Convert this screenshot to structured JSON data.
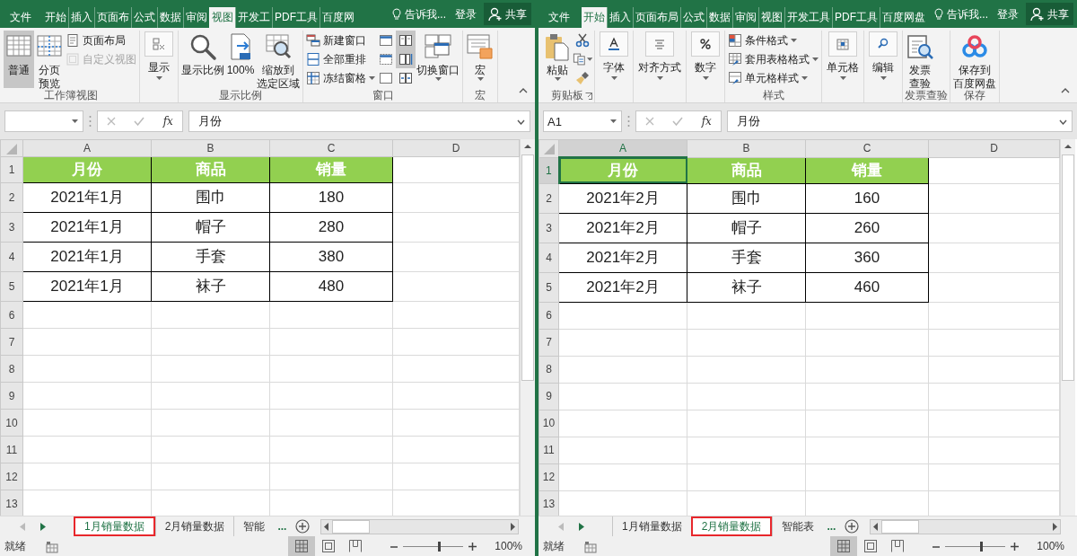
{
  "windows": [
    {
      "tabs": [
        {
          "label": "文件",
          "selected": false
        },
        {
          "label": "开始",
          "selected": false
        },
        {
          "label": "插入",
          "selected": false
        },
        {
          "label": "页面布",
          "selected": false
        },
        {
          "label": "公式",
          "selected": false
        },
        {
          "label": "数据",
          "selected": false
        },
        {
          "label": "审阅",
          "selected": false
        },
        {
          "label": "视图",
          "selected": true
        },
        {
          "label": "开发工",
          "selected": false
        },
        {
          "label": "PDF工具",
          "selected": false
        },
        {
          "label": "百度网",
          "selected": false
        }
      ],
      "tell_me": "告诉我...",
      "sign_in": "登录",
      "share": "共享",
      "ribbon": [
        {
          "label": "工作簿视图",
          "items": [
            {
              "kind": "large",
              "lines": [
                "普通"
              ],
              "selected": true
            },
            {
              "kind": "large",
              "lines": [
                "分页",
                "预览"
              ],
              "selected": false
            },
            {
              "kind": "small",
              "label": "页面布局",
              "disabled": false
            },
            {
              "kind": "small",
              "label": "自定义视图",
              "disabled": true
            }
          ]
        },
        {
          "items": [
            {
              "kind": "boxed",
              "label": "显示",
              "dropdown": true
            }
          ]
        },
        {
          "label": "显示比例",
          "items": [
            {
              "kind": "large",
              "lines": [
                "显示比例"
              ]
            },
            {
              "kind": "large",
              "lines": [
                "100%"
              ]
            },
            {
              "kind": "large",
              "lines": [
                "缩放到",
                "选定区域"
              ]
            }
          ]
        },
        {
          "label": "窗口",
          "items": [
            {
              "kind": "small",
              "label": "新建窗口"
            },
            {
              "kind": "small",
              "label": "全部重排"
            },
            {
              "kind": "small",
              "label": "冻结窗格",
              "dropdown": true
            },
            {
              "kind": "icon",
              "on": false
            },
            {
              "kind": "icon",
              "on": false
            },
            {
              "kind": "icon",
              "on": false
            },
            {
              "kind": "icon",
              "on": true
            },
            {
              "kind": "icon",
              "on": true
            },
            {
              "kind": "icon",
              "on": false
            },
            {
              "kind": "large",
              "lines": [
                "切换窗口"
              ],
              "dropdown": true
            }
          ]
        },
        {
          "label": "宏",
          "items": [
            {
              "kind": "large",
              "lines": [
                "宏"
              ],
              "dropdown": true
            }
          ]
        }
      ],
      "formula_bar": {
        "function_label": "fx",
        "formula": "月份"
      },
      "sheet": {
        "columns": [
          {
            "label": "A",
            "selected": false
          },
          {
            "label": "B",
            "selected": false
          },
          {
            "label": "C",
            "selected": false
          },
          {
            "label": "D",
            "selected": false
          }
        ],
        "rows": [
          {
            "label": "1",
            "kind": "header",
            "selected": false,
            "cells": [
              "月份",
              "商品",
              "销量"
            ]
          },
          {
            "label": "2",
            "kind": "data",
            "selected": false,
            "cells": [
              "2021年1月",
              "围巾",
              "180"
            ]
          },
          {
            "label": "3",
            "kind": "data",
            "selected": false,
            "cells": [
              "2021年1月",
              "帽子",
              "280"
            ]
          },
          {
            "label": "4",
            "kind": "data",
            "selected": false,
            "cells": [
              "2021年1月",
              "手套",
              "380"
            ]
          },
          {
            "label": "5",
            "kind": "data",
            "selected": false,
            "cells": [
              "2021年1月",
              "袜子",
              "480"
            ]
          },
          {
            "label": "6",
            "kind": "blank",
            "selected": false
          },
          {
            "label": "7",
            "kind": "blank",
            "selected": false
          },
          {
            "label": "8",
            "kind": "blank",
            "selected": false
          },
          {
            "label": "9",
            "kind": "blank",
            "selected": false
          },
          {
            "label": "10",
            "kind": "blank",
            "selected": false
          },
          {
            "label": "11",
            "kind": "blank",
            "selected": false
          },
          {
            "label": "12",
            "kind": "blank",
            "selected": false
          },
          {
            "label": "13",
            "kind": "blank",
            "selected": false
          }
        ]
      },
      "sheet_tabs": [
        {
          "label": "1月销量数据",
          "selected": true
        },
        {
          "label": "2月销量数据",
          "selected": false
        },
        {
          "label": "智能",
          "selected": false
        }
      ],
      "more_sheets": "...",
      "status": "就绪",
      "view_buttons": [
        {
          "selected": true
        },
        {
          "selected": false
        },
        {
          "selected": false
        }
      ],
      "zoom": {
        "level": 0.6,
        "label": "100%"
      }
    },
    {
      "tabs": [
        {
          "label": "文件",
          "selected": false
        },
        {
          "label": "开始",
          "selected": true
        },
        {
          "label": "插入",
          "selected": false
        },
        {
          "label": "页面布局",
          "selected": false
        },
        {
          "label": "公式",
          "selected": false
        },
        {
          "label": "数据",
          "selected": false
        },
        {
          "label": "审阅",
          "selected": false
        },
        {
          "label": "视图",
          "selected": false
        },
        {
          "label": "开发工具",
          "selected": false
        },
        {
          "label": "PDF工具",
          "selected": false
        },
        {
          "label": "百度网盘",
          "selected": false
        }
      ],
      "tell_me": "告诉我...",
      "sign_in": "登录",
      "share": "共享",
      "ribbon": [
        {
          "label": "剪贴板",
          "launcher": true,
          "items": [
            {
              "kind": "large",
              "lines": [
                "粘贴"
              ],
              "dropdown": true
            },
            {
              "kind": "icon"
            },
            {
              "kind": "icon",
              "dropdown": true
            },
            {
              "kind": "icon"
            }
          ]
        },
        {
          "items": [
            {
              "kind": "boxed",
              "label": "字体",
              "dropdown": true
            }
          ]
        },
        {
          "items": [
            {
              "kind": "boxed",
              "label": "对齐方式",
              "dropdown": true
            }
          ]
        },
        {
          "items": [
            {
              "kind": "boxed",
              "label": "数字",
              "dropdown": true
            }
          ]
        },
        {
          "label": "样式",
          "items": [
            {
              "kind": "small",
              "label": "条件格式",
              "dropdown": true
            },
            {
              "kind": "small",
              "label": "套用表格格式",
              "dropdown": true
            },
            {
              "kind": "small",
              "label": "单元格样式",
              "dropdown": true
            }
          ]
        },
        {
          "items": [
            {
              "kind": "boxed",
              "label": "单元格",
              "dropdown": true
            }
          ]
        },
        {
          "items": [
            {
              "kind": "boxed",
              "label": "编辑",
              "dropdown": true
            }
          ]
        },
        {
          "label": "发票查验",
          "items": [
            {
              "kind": "large",
              "lines": [
                "发票",
                "查验"
              ]
            }
          ]
        },
        {
          "label": "保存",
          "items": [
            {
              "kind": "large",
              "lines": [
                "保存到",
                "百度网盘"
              ]
            }
          ]
        }
      ],
      "formula_bar": {
        "name_box": "A1",
        "function_label": "fx",
        "formula": "月份"
      },
      "sheet": {
        "columns": [
          {
            "label": "A",
            "selected": true
          },
          {
            "label": "B",
            "selected": false
          },
          {
            "label": "C",
            "selected": false
          },
          {
            "label": "D",
            "selected": false
          }
        ],
        "rows": [
          {
            "label": "1",
            "kind": "header",
            "selected": true,
            "cells": [
              "月份",
              "商品",
              "销量"
            ]
          },
          {
            "label": "2",
            "kind": "data",
            "selected": false,
            "cells": [
              "2021年2月",
              "围巾",
              "160"
            ]
          },
          {
            "label": "3",
            "kind": "data",
            "selected": false,
            "cells": [
              "2021年2月",
              "帽子",
              "260"
            ]
          },
          {
            "label": "4",
            "kind": "data",
            "selected": false,
            "cells": [
              "2021年2月",
              "手套",
              "360"
            ]
          },
          {
            "label": "5",
            "kind": "data",
            "selected": false,
            "cells": [
              "2021年2月",
              "袜子",
              "460"
            ]
          },
          {
            "label": "6",
            "kind": "blank",
            "selected": false
          },
          {
            "label": "7",
            "kind": "blank",
            "selected": false
          },
          {
            "label": "8",
            "kind": "blank",
            "selected": false
          },
          {
            "label": "9",
            "kind": "blank",
            "selected": false
          },
          {
            "label": "10",
            "kind": "blank",
            "selected": false
          },
          {
            "label": "11",
            "kind": "blank",
            "selected": false
          },
          {
            "label": "12",
            "kind": "blank",
            "selected": false
          },
          {
            "label": "13",
            "kind": "blank",
            "selected": false
          }
        ]
      },
      "sheet_tabs": [
        {
          "label": "1月销量数据",
          "selected": false
        },
        {
          "label": "2月销量数据",
          "selected": true
        },
        {
          "label": "智能表",
          "selected": false
        }
      ],
      "more_sheets": "...",
      "status": "就绪",
      "view_buttons": [
        {
          "selected": true
        },
        {
          "selected": false
        },
        {
          "selected": false
        }
      ],
      "zoom": {
        "level": 0.6,
        "label": "100%"
      }
    }
  ]
}
